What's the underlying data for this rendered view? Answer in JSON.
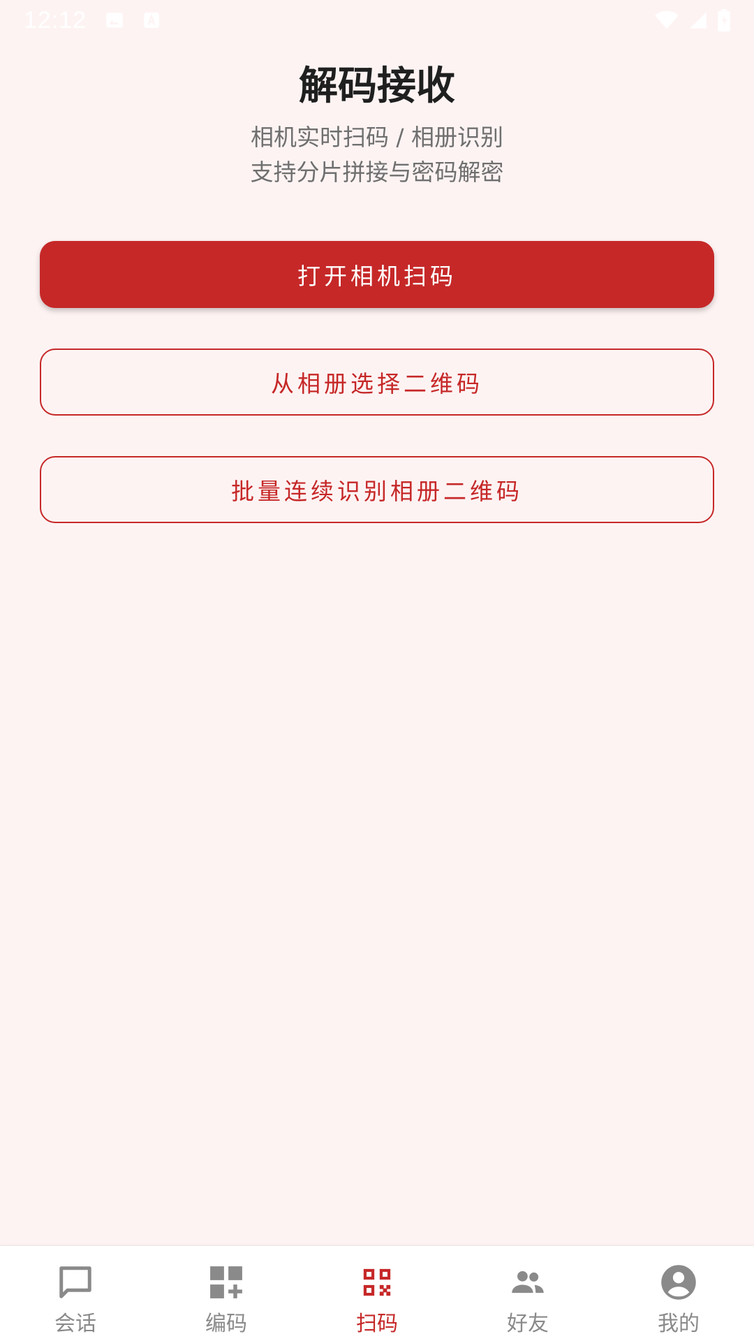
{
  "status_bar": {
    "time": "12:12",
    "icons": [
      "image-icon",
      "font-icon",
      "wifi-icon",
      "signal-icon",
      "battery-icon"
    ]
  },
  "header": {
    "title": "解码接收",
    "subtitle_line1": "相机实时扫码 / 相册识别",
    "subtitle_line2": "支持分片拼接与密码解密"
  },
  "actions": {
    "camera_scan": "打开相机扫码",
    "pick_album": "从相册选择二维码",
    "batch_album": "批量连续识别相册二维码"
  },
  "bottom_nav": {
    "items": [
      {
        "label": "会话",
        "icon": "chat-icon",
        "active": false
      },
      {
        "label": "编码",
        "icon": "grid-add-icon",
        "active": false
      },
      {
        "label": "扫码",
        "icon": "qr-code-icon",
        "active": true
      },
      {
        "label": "好友",
        "icon": "people-icon",
        "active": false
      },
      {
        "label": "我的",
        "icon": "account-circle-icon",
        "active": false
      }
    ]
  },
  "colors": {
    "accent": "#c62828",
    "background": "#fef3f3",
    "nav_inactive": "#8a8a8a"
  }
}
